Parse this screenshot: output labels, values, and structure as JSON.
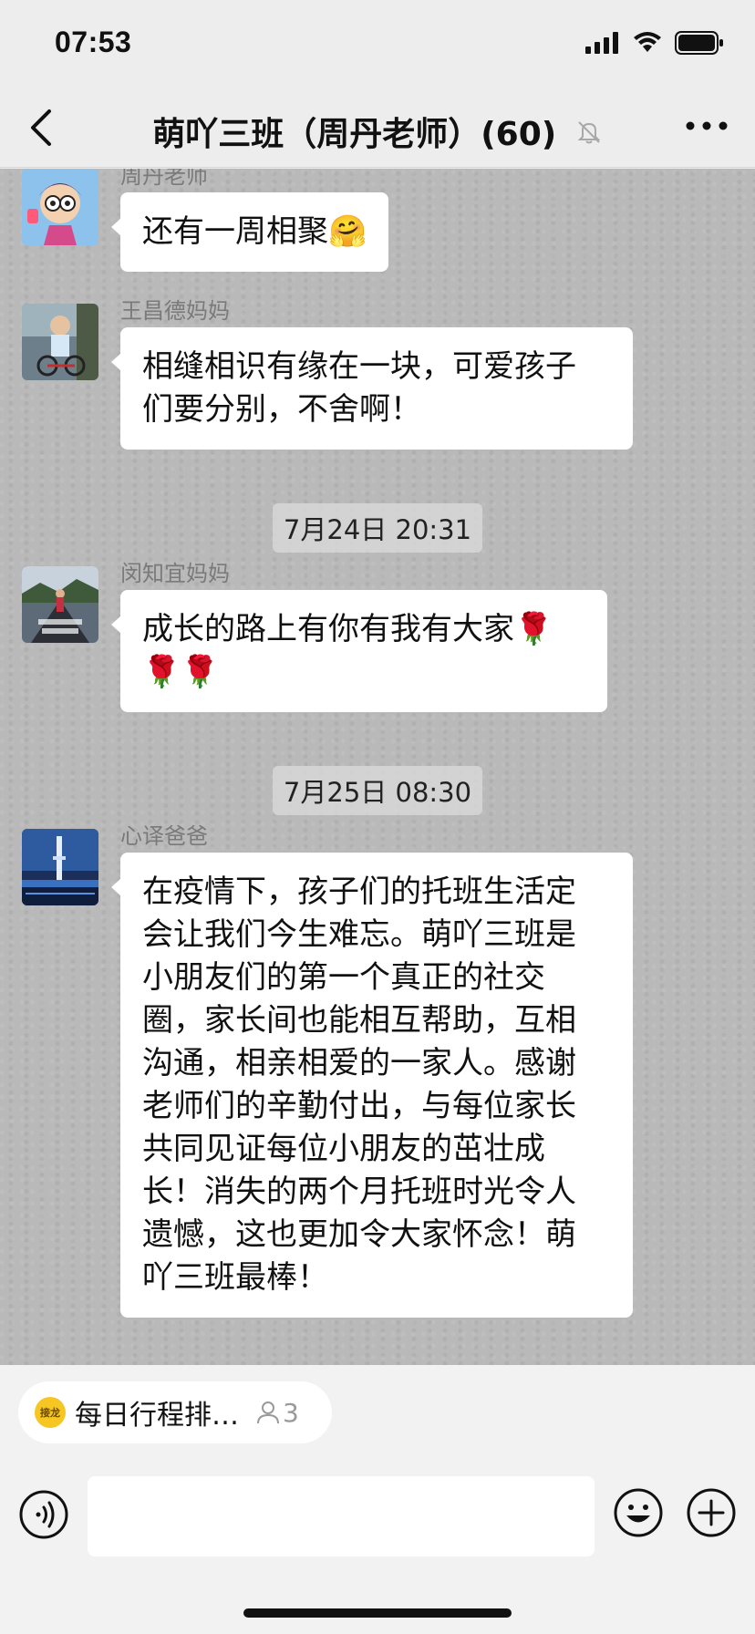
{
  "status_bar": {
    "time": "07:53",
    "icons": [
      "signal-icon",
      "wifi-icon",
      "battery-icon"
    ]
  },
  "nav": {
    "title": "萌吖三班（周丹老师）",
    "member_count": "(60)",
    "icons": [
      "back-icon",
      "mute-bell-icon",
      "more-icon"
    ]
  },
  "messages": [
    {
      "sender": "周丹老师",
      "text": "还有一周相聚🤗"
    },
    {
      "sender": "王昌德妈妈",
      "lines": [
        "相缝相识有缘在一块，可爱孩子",
        "们要分别，不舍啊！"
      ]
    },
    {
      "sender": "闵知宜妈妈",
      "lines": [
        "成长的路上有你有我有大家🌹",
        "🌹🌹"
      ]
    },
    {
      "sender": "心译爸爸",
      "lines": [
        "在疫情下，孩子们的托班生活定",
        "会让我们今生难忘。萌吖三班是",
        "小朋友们的第一个真正的社交",
        "圈，家长间也能相互帮助，互相",
        "沟通，相亲相爱的一家人。感谢",
        "老师们的辛勤付出，与每位家长",
        "共同见证每位小朋友的茁壮成",
        "长！消失的两个月托班时光令人",
        "遗憾，这也更加令大家怀念！萌",
        "吖三班最棒！"
      ]
    }
  ],
  "timestamps": [
    "7月24日 20:31",
    "7月25日 08:30"
  ],
  "mini_program": {
    "logo_text": "接龙",
    "label": "每日行程排…",
    "participants": "3"
  },
  "input": {
    "value": "",
    "placeholder": ""
  },
  "colors": {
    "chat_bg": "#b9b9b9",
    "bar_bg": "#ededed",
    "bubble": "#ffffff",
    "mini_logo": "#f6c623"
  }
}
